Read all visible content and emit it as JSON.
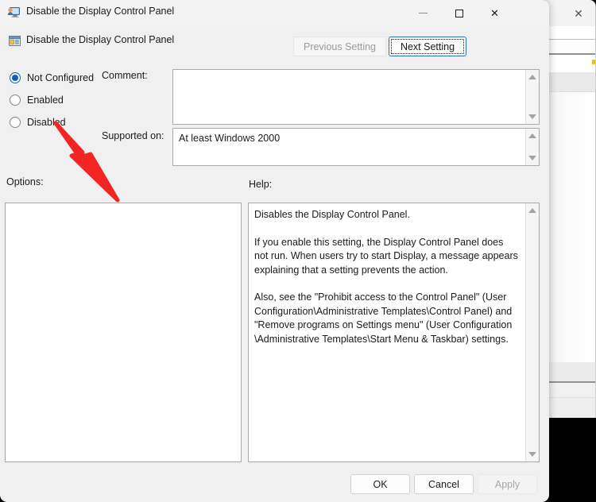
{
  "window": {
    "title": "Disable the Display Control Panel",
    "title_icon": "display-monitor-icon",
    "minimize_label": "—",
    "maximize_label": "□",
    "close_label": "✕"
  },
  "background_window": {
    "close_label": "✕"
  },
  "header": {
    "setting_icon": "policy-setting-icon",
    "setting_name": "Disable the Display Control Panel",
    "previous_setting_label": "Previous Setting",
    "next_setting_label": "Next Setting",
    "previous_enabled": false,
    "next_focused": true
  },
  "state_options": [
    {
      "label": "Not Configured",
      "selected": true
    },
    {
      "label": "Enabled",
      "selected": false
    },
    {
      "label": "Disabled",
      "selected": false
    }
  ],
  "fields": {
    "comment_label": "Comment:",
    "comment_value": "",
    "supported_label": "Supported on:",
    "supported_value": "At least Windows 2000"
  },
  "panels": {
    "options_label": "Options:",
    "options_value": "",
    "help_label": "Help:",
    "help_paragraphs": [
      "Disables the Display Control Panel.",
      "If you enable this setting, the Display Control Panel does not run. When users try to start Display, a message appears explaining that a setting prevents the action.",
      "Also, see the \"Prohibit access to the Control Panel\" (User Configuration\\Administrative Templates\\Control Panel) and \"Remove programs on Settings menu\" (User Configuration \\Administrative Templates\\Start Menu & Taskbar) settings."
    ]
  },
  "footer": {
    "ok_label": "OK",
    "cancel_label": "Cancel",
    "apply_label": "Apply",
    "apply_enabled": false
  },
  "annotation": {
    "arrow_color": "#f22424",
    "points_to": "Disabled"
  },
  "colors": {
    "accent": "#0e5fb5",
    "dialog_bg": "#f0f0f0",
    "titlebar_bg": "#f3f3f3",
    "arrow_red": "#f22424"
  }
}
